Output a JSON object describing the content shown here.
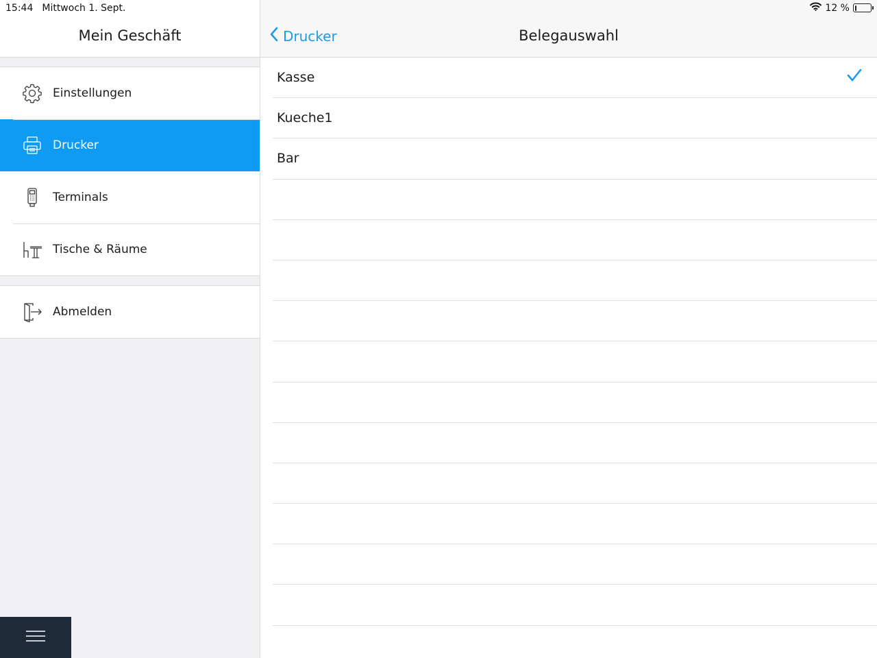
{
  "status_bar": {
    "time": "15:44",
    "date": "Mittwoch 1. Sept.",
    "battery_text": "12 %",
    "battery_level": 0.12
  },
  "sidebar": {
    "title": "Mein Geschäft",
    "groups": [
      {
        "items": [
          {
            "label": "Einstellungen",
            "icon": "gear-icon",
            "active": false
          },
          {
            "label": "Drucker",
            "icon": "printer-icon",
            "active": true
          },
          {
            "label": "Terminals",
            "icon": "card-terminal-icon",
            "active": false
          },
          {
            "label": "Tische & Räume",
            "icon": "table-chair-icon",
            "active": false
          }
        ]
      },
      {
        "items": [
          {
            "label": "Abmelden",
            "icon": "logout-icon",
            "active": false
          }
        ]
      }
    ],
    "menu_button_icon": "hamburger-icon"
  },
  "detail": {
    "back_label": "Drucker",
    "title": "Belegauswahl",
    "rows": [
      {
        "label": "Kasse",
        "selected": true
      },
      {
        "label": "Kueche1",
        "selected": false
      },
      {
        "label": "Bar",
        "selected": false
      },
      {
        "label": "",
        "selected": false
      },
      {
        "label": "",
        "selected": false
      },
      {
        "label": "",
        "selected": false
      },
      {
        "label": "",
        "selected": false
      },
      {
        "label": "",
        "selected": false
      },
      {
        "label": "",
        "selected": false
      },
      {
        "label": "",
        "selected": false
      },
      {
        "label": "",
        "selected": false
      },
      {
        "label": "",
        "selected": false
      },
      {
        "label": "",
        "selected": false
      },
      {
        "label": "",
        "selected": false
      }
    ]
  },
  "colors": {
    "accent": "#0f9bf1",
    "link": "#1a9bea",
    "menu_button_bg": "#1e2a38"
  }
}
